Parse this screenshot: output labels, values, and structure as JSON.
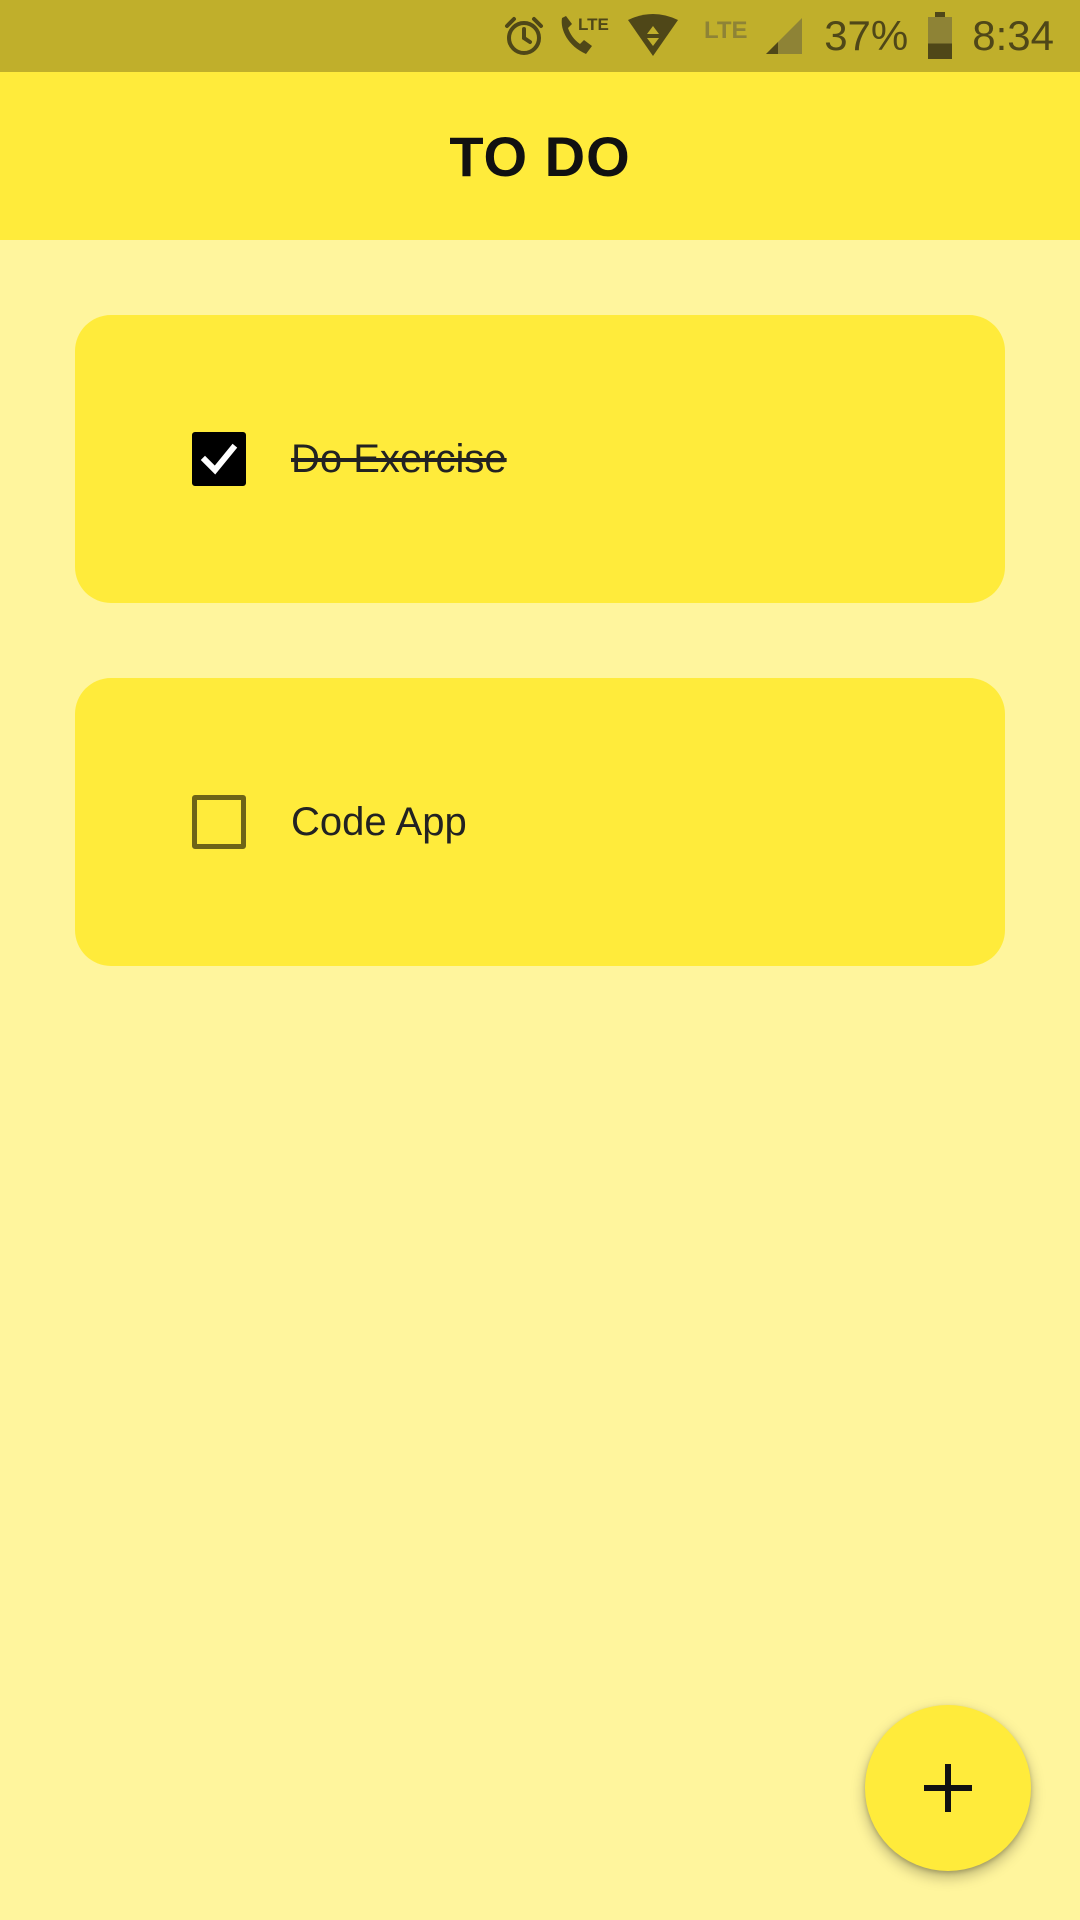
{
  "status_bar": {
    "lte_call_label": "LTE",
    "lte_label": "LTE",
    "battery_percent": "37%",
    "battery_level": 0.37,
    "time": "8:34",
    "icons": [
      "alarm-icon",
      "lte-call-icon",
      "wifi-data-icon",
      "lte-icon",
      "signal-icon",
      "battery-icon"
    ]
  },
  "app_bar": {
    "title": "TO DO"
  },
  "todos": [
    {
      "label": "Do Exercise",
      "checked": true
    },
    {
      "label": "Code App",
      "checked": false
    }
  ],
  "fab": {
    "icon": "plus-icon"
  },
  "colors": {
    "status_bar": "#C0AF2B",
    "app_bar": "#FFEB3B",
    "background": "#FFF59D",
    "card": "#FFEB3B",
    "fab": "#FFEB3B"
  }
}
